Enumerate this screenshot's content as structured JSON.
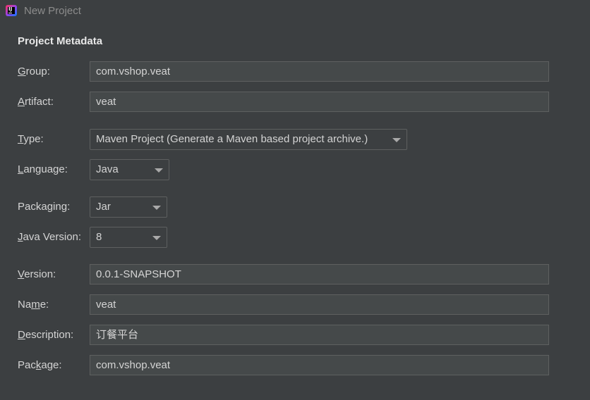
{
  "window": {
    "title": "New Project"
  },
  "section_title": "Project Metadata",
  "fields": {
    "group": {
      "label_pre": "",
      "label_key": "G",
      "label_post": "roup:",
      "value": "com.vshop.veat"
    },
    "artifact": {
      "label_pre": "",
      "label_key": "A",
      "label_post": "rtifact:",
      "value": "veat"
    },
    "type": {
      "label_pre": "",
      "label_key": "T",
      "label_post": "ype:",
      "value": "Maven Project (Generate a Maven based project archive.)"
    },
    "language": {
      "label_pre": "",
      "label_key": "L",
      "label_post": "anguage:",
      "value": "Java"
    },
    "packaging": {
      "label_pre": "Packa",
      "label_key": "g",
      "label_post": "ing:",
      "value": "Jar"
    },
    "java_version": {
      "label_pre": "",
      "label_key": "J",
      "label_post": "ava Version:",
      "value": "8"
    },
    "version": {
      "label_pre": "",
      "label_key": "V",
      "label_post": "ersion:",
      "value": "0.0.1-SNAPSHOT"
    },
    "name": {
      "label_pre": "Na",
      "label_key": "m",
      "label_post": "e:",
      "value": "veat"
    },
    "description": {
      "label_pre": "",
      "label_key": "D",
      "label_post": "escription:",
      "value": "订餐平台"
    },
    "package": {
      "label_pre": "Pac",
      "label_key": "k",
      "label_post": "age:",
      "value": "com.vshop.veat"
    }
  },
  "icons": {
    "app": "intellij-idea-icon",
    "dropdown": "chevron-down-icon"
  },
  "colors": {
    "background": "#3c3f41",
    "field_bg": "#45494a",
    "border": "#5e6060",
    "text": "#d4d4d4"
  }
}
